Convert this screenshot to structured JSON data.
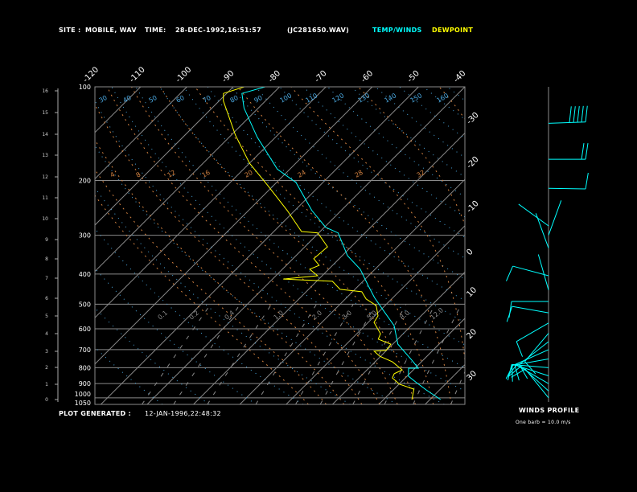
{
  "header": {
    "site_label": "SITE :",
    "site_value": "MOBILE, WAV",
    "time_label": "TIME:",
    "time_value": "28-DEC-1992,16:51:57",
    "file": "(JC281650.WAV)",
    "legend_temp": "TEMP/WINDS",
    "legend_dew": "DEWPOINT"
  },
  "footer": {
    "generated_label": "PLOT GENERATED :",
    "generated_value": "12-JAN-1996,22:48:32",
    "winds_title": "WINDS PROFILE",
    "winds_note": "One barb = 10.0 m/s"
  },
  "colors": {
    "background": "#000000",
    "temperature": "#00ffff",
    "dewpoint": "#ffff00",
    "isotherm": "#8a8a8a",
    "dry_adiabat": "#4aa8e0",
    "moist_adiabat": "#d08040",
    "mixing_ratio": "#8a8a8a"
  },
  "chart_data": {
    "type": "skew-t log-p",
    "pressure_axis": {
      "unit": "hPa",
      "range": [
        1050,
        100
      ],
      "scale": "log",
      "ticks": [
        "100",
        "200",
        "300",
        "400",
        "500",
        "600",
        "700",
        "800",
        "900",
        "1000",
        "1050"
      ]
    },
    "height_axis": {
      "unit": "km",
      "ticks": [
        "0",
        "1",
        "2",
        "3",
        "4",
        "5",
        "6",
        "7",
        "8",
        "9",
        "10",
        "11",
        "12",
        "13",
        "14",
        "15",
        "16"
      ]
    },
    "isotherm_labels_top": [
      "-120",
      "-110",
      "-100",
      "-90",
      "-80",
      "-70",
      "-60",
      "-50",
      "-40"
    ],
    "isotherm_labels_right": [
      "-30",
      "-20",
      "-10",
      "0",
      "10",
      "20",
      "30"
    ],
    "dry_adiabat_labels": [
      "30",
      "40",
      "50",
      "60",
      "70",
      "80",
      "90",
      "100",
      "110",
      "120",
      "130",
      "140",
      "150",
      "160"
    ],
    "moist_adiabat_labels": [
      "4",
      "8",
      "12",
      "16",
      "20",
      "24",
      "28",
      "32"
    ],
    "mixing_ratio_labels": [
      "0.1",
      "0.2",
      "0.4",
      "1.0",
      "2.0",
      "3.0",
      "5.0",
      "8.0",
      "12.0"
    ],
    "series": [
      {
        "name": "TEMP/WINDS",
        "color": "#00ffff",
        "points": [
          [
            1013,
            22.3
          ],
          [
            943,
            17.1
          ],
          [
            889,
            13.1
          ],
          [
            852,
            10.3
          ],
          [
            803,
            8.6
          ],
          [
            803,
            10.7
          ],
          [
            757,
            7.6
          ],
          [
            672,
            1.1
          ],
          [
            586,
            -3.7
          ],
          [
            529,
            -8.8
          ],
          [
            476,
            -14.0
          ],
          [
            435,
            -18.0
          ],
          [
            386,
            -23.2
          ],
          [
            349,
            -28.9
          ],
          [
            295,
            -35.8
          ],
          [
            283,
            -39.7
          ],
          [
            250,
            -46.3
          ],
          [
            203,
            -55.8
          ],
          [
            184,
            -62.7
          ],
          [
            145,
            -74.0
          ],
          [
            117,
            -83.1
          ],
          [
            105,
            -86.7
          ],
          [
            100,
            -83.1
          ]
        ]
      },
      {
        "name": "DEWPOINT",
        "color": "#ffff00",
        "points": [
          [
            1013,
            16.1
          ],
          [
            938,
            14.3
          ],
          [
            905,
            10.2
          ],
          [
            863,
            7.2
          ],
          [
            837,
            6.7
          ],
          [
            813,
            7.6
          ],
          [
            766,
            3.75
          ],
          [
            735,
            -0.2
          ],
          [
            708,
            -2.5
          ],
          [
            704,
            -0.1
          ],
          [
            672,
            -0.4
          ],
          [
            648,
            -4.2
          ],
          [
            622,
            -4.9
          ],
          [
            572,
            -8.75
          ],
          [
            545,
            -9.3
          ],
          [
            505,
            -11.9
          ],
          [
            481,
            -15.5
          ],
          [
            456,
            -18.0
          ],
          [
            448,
            -23.2
          ],
          [
            422,
            -26.6
          ],
          [
            415,
            -37.7
          ],
          [
            405,
            -31.0
          ],
          [
            386,
            -34.1
          ],
          [
            375,
            -32.9
          ],
          [
            357,
            -35.5
          ],
          [
            327,
            -35.1
          ],
          [
            295,
            -40.2
          ],
          [
            292,
            -44.0
          ],
          [
            250,
            -51.6
          ],
          [
            207,
            -61.4
          ],
          [
            176,
            -70.0
          ],
          [
            143,
            -79.1
          ],
          [
            111,
            -89.1
          ],
          [
            105,
            -90.7
          ],
          [
            100,
            -87.6
          ]
        ]
      }
    ],
    "winds": [
      {
        "p": 131,
        "dir": 268,
        "speed_ms": 50
      },
      {
        "p": 171,
        "dir": 270,
        "speed_ms": 20
      },
      {
        "p": 212,
        "dir": 271,
        "speed_ms": 10
      },
      {
        "p": 280,
        "dir": 126,
        "speed_ms": 5
      },
      {
        "p": 300,
        "dir": 200,
        "speed_ms": 5
      },
      {
        "p": 330,
        "dir": 160,
        "speed_ms": 5
      },
      {
        "p": 405,
        "dir": 105,
        "speed_ms": 10
      },
      {
        "p": 450,
        "dir": 164,
        "speed_ms": 5
      },
      {
        "p": 490,
        "dir": 90,
        "speed_ms": 10
      },
      {
        "p": 533,
        "dir": 100,
        "speed_ms": 10
      },
      {
        "p": 575,
        "dir": 60,
        "speed_ms": 10
      },
      {
        "p": 620,
        "dir": 40,
        "speed_ms": 10
      },
      {
        "p": 660,
        "dir": 52,
        "speed_ms": 10
      },
      {
        "p": 700,
        "dir": 66,
        "speed_ms": 10
      },
      {
        "p": 750,
        "dir": 80,
        "speed_ms": 10
      },
      {
        "p": 800,
        "dir": 95,
        "speed_ms": 10
      },
      {
        "p": 850,
        "dir": 108,
        "speed_ms": 10
      },
      {
        "p": 900,
        "dir": 120,
        "speed_ms": 10
      },
      {
        "p": 950,
        "dir": 132,
        "speed_ms": 10
      },
      {
        "p": 1000,
        "dir": 141,
        "speed_ms": 10
      }
    ]
  }
}
